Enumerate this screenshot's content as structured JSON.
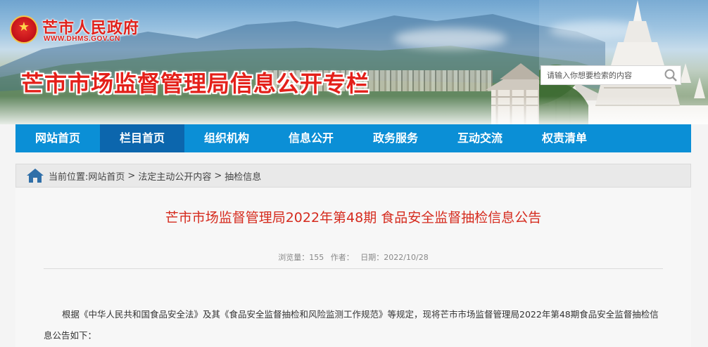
{
  "header": {
    "gov_name": "芒市人民政府",
    "gov_url": "WWW.DHMS.GOV.CN",
    "site_title": "芒市市场监督管理局信息公开专栏",
    "search_placeholder": "请输入你想要检索的内容",
    "icons": {
      "emblem": "national-emblem-icon",
      "search": "search-icon"
    }
  },
  "nav": {
    "items": [
      {
        "label": "网站首页"
      },
      {
        "label": "栏目首页"
      },
      {
        "label": "组织机构"
      },
      {
        "label": "信息公开"
      },
      {
        "label": "政务服务"
      },
      {
        "label": "互动交流"
      },
      {
        "label": "权责清单"
      }
    ],
    "active_index": 1
  },
  "breadcrumb": {
    "prefix": "当前位置:",
    "items": [
      "网站首页",
      "法定主动公开内容",
      "抽检信息"
    ],
    "separator": ">",
    "icon": "home-icon"
  },
  "article": {
    "title": "芒市市场监督管理局2022年第48期 食品安全监督抽检信息公告",
    "views": "浏览量：155",
    "author": "作者：",
    "date": "日期：2022/10/28",
    "body": "根据《中华人民共和国食品安全法》及其《食品安全监督抽检和风险监测工作规范》等规定，现将芒市市场监督管理局2022年第48期食品安全监督抽检信息公告如下："
  },
  "colors": {
    "nav_bg": "#0b8fd6",
    "nav_active": "#0c66ad",
    "title_red": "#d52b1e",
    "brand_red": "#e4201a"
  }
}
